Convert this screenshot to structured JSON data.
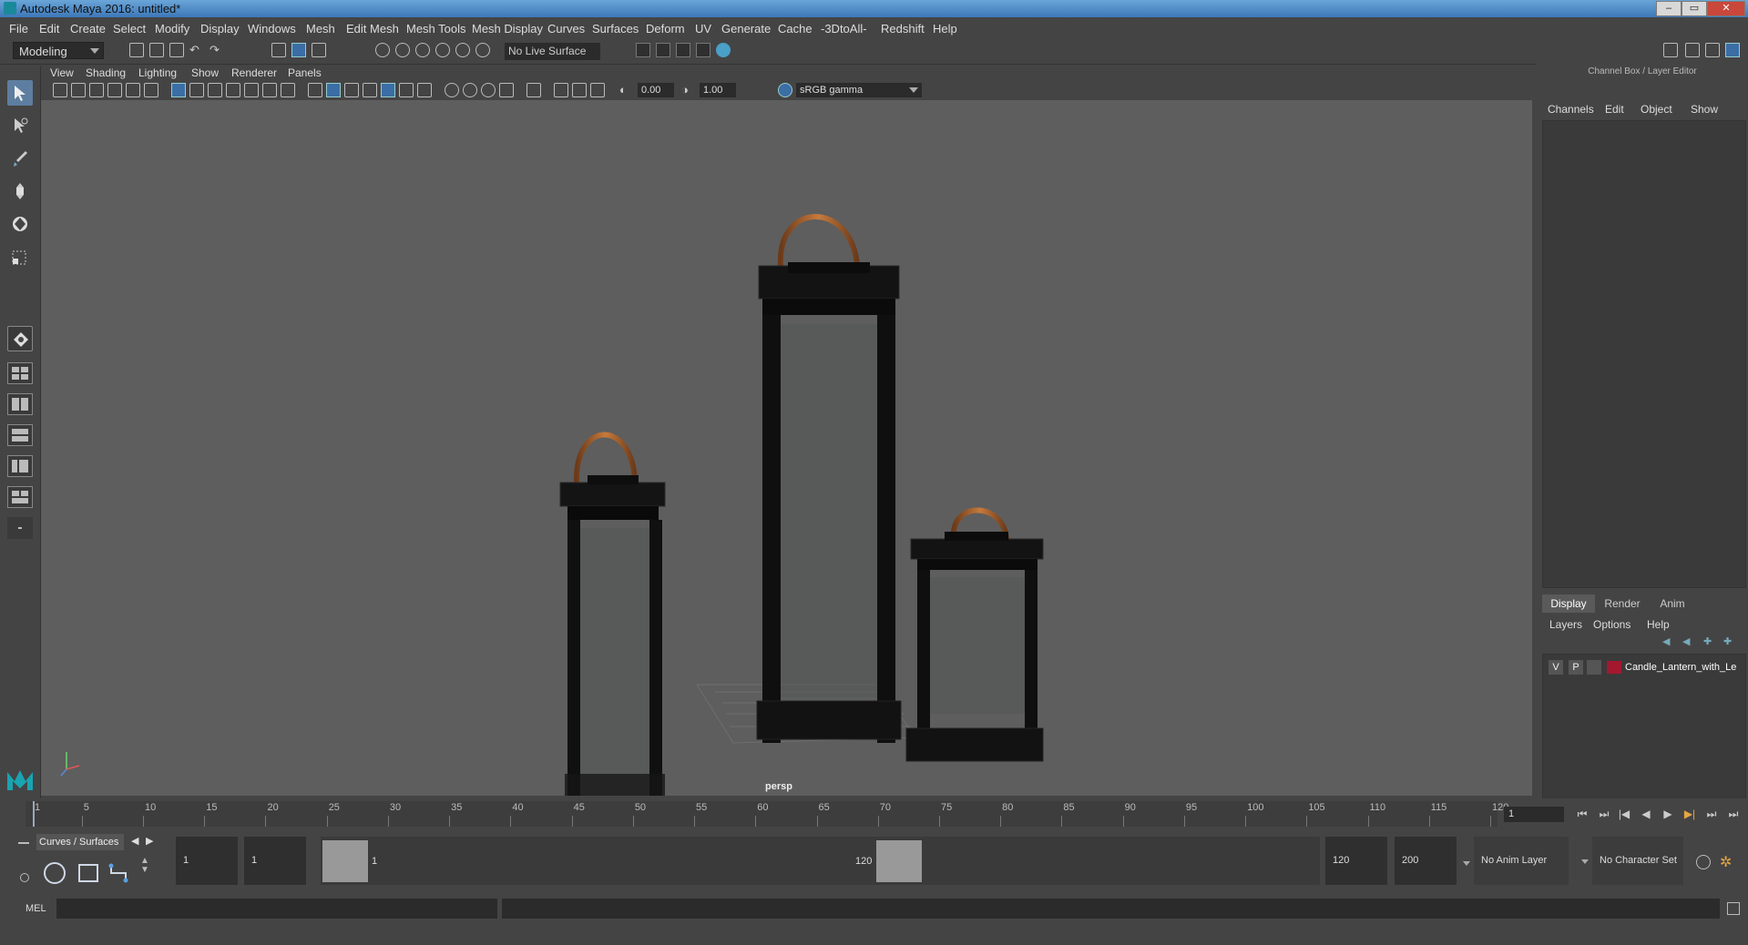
{
  "window": {
    "title": "Autodesk Maya 2016: untitled*"
  },
  "menubar": [
    "File",
    "Edit",
    "Create",
    "Select",
    "Modify",
    "Display",
    "Windows",
    "Mesh",
    "Edit Mesh",
    "Mesh Tools",
    "Mesh Display",
    "Curves",
    "Surfaces",
    "Deform",
    "UV",
    "Generate",
    "Cache",
    "-3DtoAll-",
    "Redshift",
    "Help"
  ],
  "shelf": {
    "mode": "Modeling",
    "live_surface": "No Live Surface"
  },
  "viewport": {
    "menu": [
      "View",
      "Shading",
      "Lighting",
      "Show",
      "Renderer",
      "Panels"
    ],
    "exposure": "0.00",
    "gamma": "1.00",
    "colorspace": "sRGB gamma",
    "camera_label": "persp"
  },
  "channel_box": {
    "header": "Channel Box / Layer Editor",
    "menu": [
      "Channels",
      "Edit",
      "Object",
      "Show"
    ]
  },
  "layer_editor": {
    "tabs": [
      "Display",
      "Render",
      "Anim"
    ],
    "menu": [
      "Layers",
      "Options",
      "Help"
    ],
    "layers": [
      {
        "v": "V",
        "p": "P",
        "name": "Candle_Lantern_with_Le",
        "color": "#a3182f"
      }
    ]
  },
  "timeline": {
    "ticks": [
      "1",
      "5",
      "10",
      "15",
      "20",
      "25",
      "30",
      "35",
      "40",
      "45",
      "50",
      "55",
      "60",
      "65",
      "70",
      "75",
      "80",
      "85",
      "90",
      "95",
      "100",
      "105",
      "110",
      "115",
      "120"
    ],
    "current_frame": "1"
  },
  "range": {
    "shelf_tab": "Curves / Surfaces",
    "start_time": "1",
    "playback_start": "1",
    "slider_start": "1",
    "slider_end": "120",
    "playback_end": "120",
    "end_time": "200",
    "anim_layer": "No Anim Layer",
    "character_set": "No Character Set"
  },
  "command_line": {
    "label": "MEL"
  }
}
